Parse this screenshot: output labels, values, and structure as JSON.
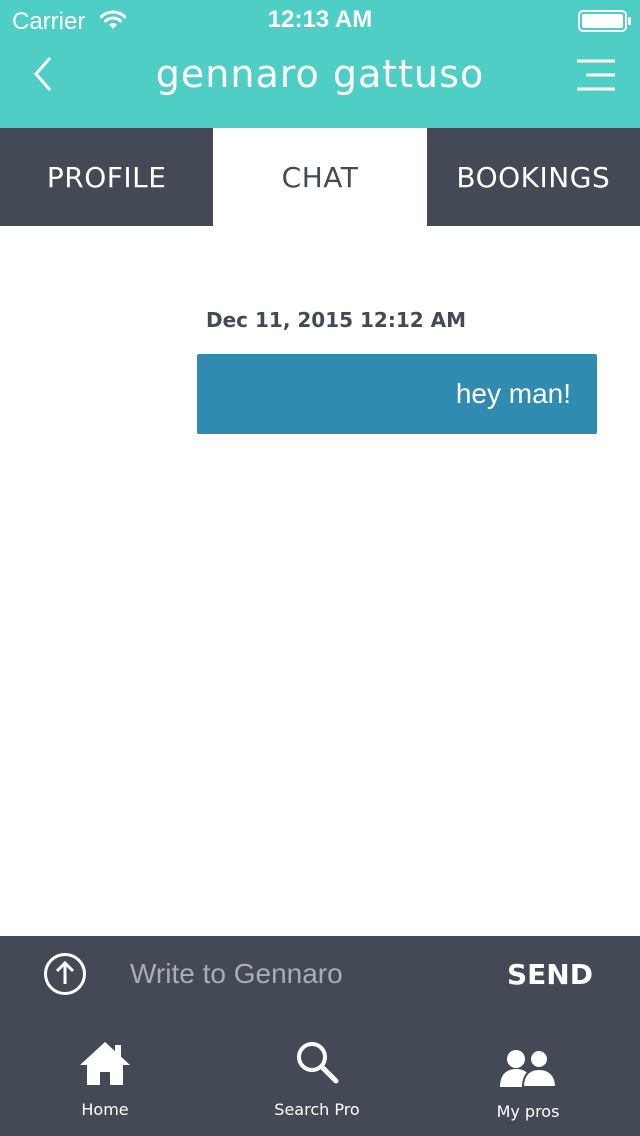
{
  "status_bar": {
    "carrier": "Carrier",
    "time": "12:13 AM",
    "wifi_icon": "wifi-icon",
    "battery_icon": "battery-icon"
  },
  "header": {
    "title": "gennaro gattuso",
    "back_icon": "chevron-left-icon",
    "menu_icon": "hamburger-menu-icon",
    "background_color": "#4fcec5"
  },
  "tabs": [
    {
      "label": "PROFILE",
      "active": false
    },
    {
      "label": "CHAT",
      "active": true
    },
    {
      "label": "BOOKINGS",
      "active": false
    }
  ],
  "chat": {
    "messages": [
      {
        "timestamp": "Dec 11, 2015 12:12 AM",
        "text": "hey man!",
        "bubble_color": "#2f8bb0"
      }
    ]
  },
  "compose": {
    "upload_icon": "arrow-up-circle-icon",
    "placeholder": "Write to Gennaro",
    "value": "",
    "send_label": "SEND"
  },
  "bottom_nav": {
    "items": [
      {
        "label": "Home",
        "icon": "home-icon"
      },
      {
        "label": "Search Pro",
        "icon": "search-icon"
      },
      {
        "label": "My pros",
        "icon": "people-icon"
      }
    ]
  },
  "colors": {
    "dark": "#434a55",
    "accent": "#4fcec5",
    "bubble": "#2f8bb0"
  }
}
